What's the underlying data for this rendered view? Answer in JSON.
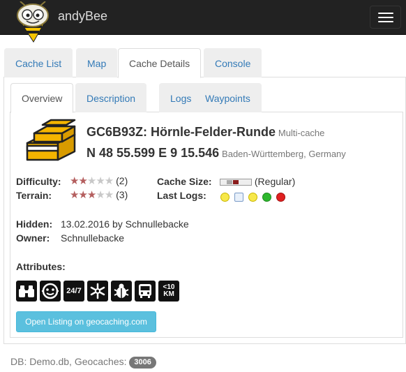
{
  "app": {
    "name": "andyBee"
  },
  "main_tabs": [
    {
      "label": "Cache List",
      "active": false
    },
    {
      "label": "Map",
      "active": false
    },
    {
      "label": "Cache Details",
      "active": true
    },
    {
      "label": "Console",
      "active": false
    }
  ],
  "detail_tabs": [
    {
      "label": "Overview",
      "active": true
    },
    {
      "label": "Description",
      "active": false
    },
    {
      "label": "Logs",
      "active": false
    },
    {
      "label": "Waypoints",
      "active": false
    }
  ],
  "cache": {
    "title": "GC6B93Z: Hörnle-Felder-Runde",
    "type": "Multi-cache",
    "coords": "N 48 55.599 E 9 15.546",
    "location": "Baden-Württemberg, Germany",
    "difficulty_label": "Difficulty:",
    "difficulty_value": "(2)",
    "difficulty_rating": 2,
    "terrain_label": "Terrain:",
    "terrain_value": "(3)",
    "terrain_rating": 3,
    "size_label": "Cache Size:",
    "size_value": "(Regular)",
    "last_logs_label": "Last Logs:",
    "last_logs": [
      "smile-icon",
      "note-icon",
      "smile-icon",
      "check-icon",
      "no-entry-icon"
    ],
    "hidden_label": "Hidden:",
    "hidden_value": "13.02.2016 by Schnullebacke",
    "owner_label": "Owner:",
    "owner_value": "Schnullebacke",
    "attributes_label": "Attributes:",
    "attributes": [
      "binoculars-icon",
      "kids-icon",
      "24/7",
      "snowflake-icon",
      "bug-icon",
      "bus-icon",
      "<10 KM"
    ],
    "open_listing_label": "Open Listing on geocaching.com"
  },
  "footer": {
    "db_text": "DB: Demo.db, Geocaches:",
    "count": "3006"
  },
  "colors": {
    "navbar": "#222222",
    "link": "#337ab7",
    "info_button": "#5bc0de",
    "star": "#b45e5e"
  }
}
